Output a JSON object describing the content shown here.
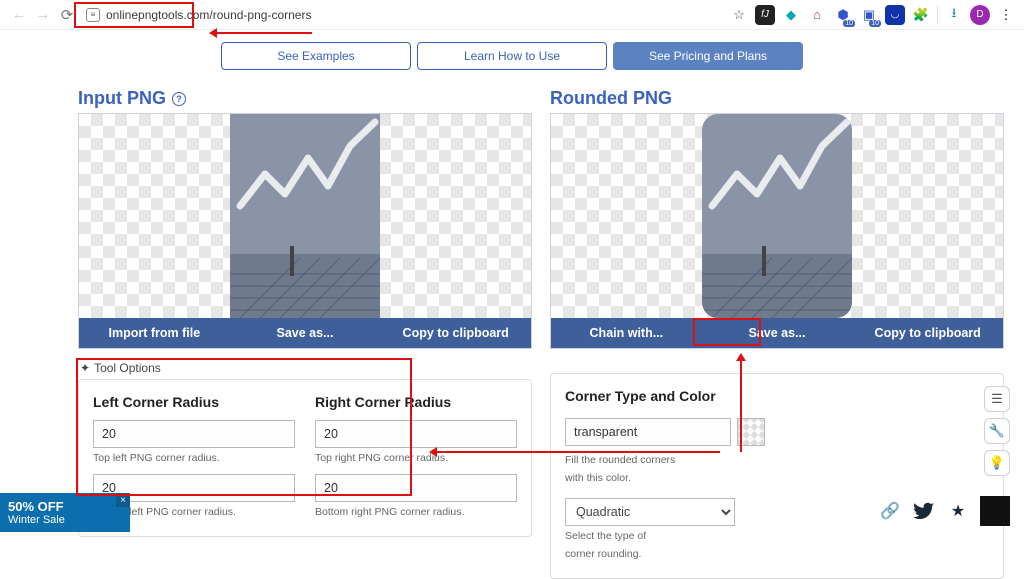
{
  "browser": {
    "url": "onlinepngtools.com/round-png-corners"
  },
  "top_buttons": {
    "examples": "See Examples",
    "howto": "Learn How to Use",
    "pricing": "See Pricing and Plans"
  },
  "left_panel": {
    "title": "Input PNG",
    "actions": {
      "import": "Import from file",
      "save": "Save as...",
      "copy": "Copy to clipboard"
    }
  },
  "right_panel": {
    "title": "Rounded PNG",
    "actions": {
      "chain": "Chain with...",
      "save": "Save as...",
      "copy": "Copy to clipboard"
    }
  },
  "tool_options": {
    "header": "Tool Options",
    "left_title": "Left Corner Radius",
    "right_title": "Right Corner Radius",
    "tl_value": "20",
    "tl_hint": "Top left PNG corner radius.",
    "bl_value": "20",
    "bl_hint": "Bottom left PNG corner radius.",
    "tr_value": "20",
    "tr_hint": "Top right PNG corner radius.",
    "br_value": "20",
    "br_hint": "Bottom right PNG corner radius.",
    "color_title": "Corner Type and Color",
    "color_value": "transparent",
    "color_hint1": "Fill the rounded corners",
    "color_hint2": "with this color.",
    "type_value": "Quadratic",
    "type_hint1": "Select the type of",
    "type_hint2": "corner rounding."
  },
  "promo": {
    "pct": "50% OFF",
    "label": "Winter Sale"
  }
}
